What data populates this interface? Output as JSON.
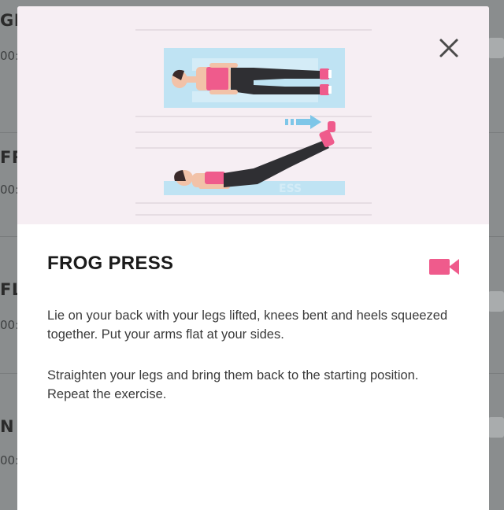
{
  "background_list": {
    "items": [
      {
        "title_fragment": "GL",
        "time_fragment": "00:"
      },
      {
        "title_fragment": "FR",
        "time_fragment": "00:"
      },
      {
        "title_fragment": "FLU",
        "time_fragment": "00:"
      },
      {
        "title_fragment": "N",
        "time_fragment": "00:"
      }
    ]
  },
  "modal": {
    "close_icon": "close-icon",
    "illustration": "frog-press-illustration",
    "exercise_title": "FROG PRESS",
    "video_icon": "video-camera-icon",
    "description": [
      "Lie on your back with your legs lifted, knees bent and heels squeezed together. Put your arms flat at your sides.",
      "Straighten your legs and bring them back to the starting position. Repeat the exercise."
    ]
  },
  "colors": {
    "accent": "#ef5b8c",
    "hero_background": "#f6eef3",
    "overlay": "#8a8d8e",
    "mat": "#bfe3f3"
  }
}
